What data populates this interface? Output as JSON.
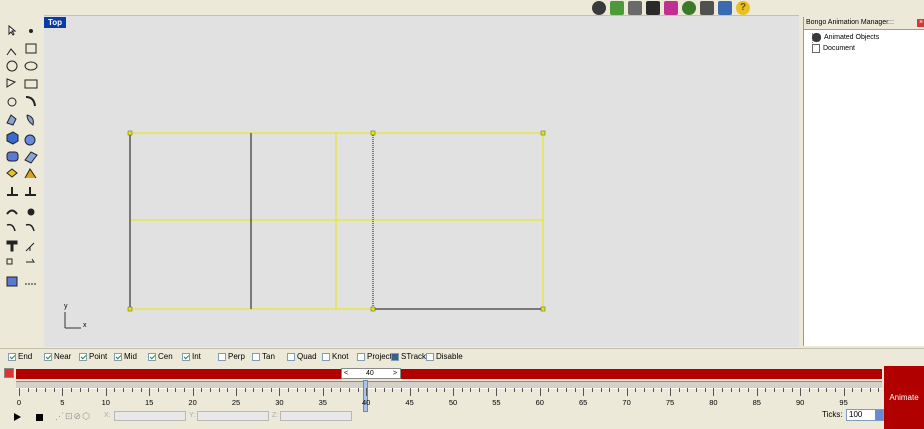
{
  "viewport": {
    "tab_label": "Top",
    "axis_x": "x",
    "axis_y": "y"
  },
  "panel": {
    "title": "Bongo Animation Manager",
    "close": "×",
    "tree": [
      {
        "label": "Animated Objects"
      },
      {
        "label": "Document"
      }
    ]
  },
  "snaps": [
    {
      "label": "End",
      "checked": true
    },
    {
      "label": "Near",
      "checked": true
    },
    {
      "label": "Point",
      "checked": true
    },
    {
      "label": "Mid",
      "checked": true
    },
    {
      "label": "Cen",
      "checked": true
    },
    {
      "label": "Int",
      "checked": true
    },
    {
      "label": "Perp",
      "checked": false
    },
    {
      "label": "Tan",
      "checked": false
    },
    {
      "label": "Quad",
      "checked": false
    },
    {
      "label": "Knot",
      "checked": false
    },
    {
      "label": "Project",
      "checked": false
    },
    {
      "label": "STrack",
      "checked": true
    },
    {
      "label": "Disable",
      "checked": false
    }
  ],
  "timeline": {
    "current_frame": "40",
    "prev": "<",
    "next": ">",
    "ticks_label": "Ticks:",
    "ticks_value": "100",
    "ruler_labels": [
      "0",
      "5",
      "10",
      "15",
      "20",
      "25",
      "30",
      "35",
      "40",
      "45",
      "50",
      "55",
      "60",
      "65",
      "70",
      "75",
      "80",
      "85",
      "90",
      "95"
    ],
    "animate_label": "Animate",
    "coord_labels": {
      "x": "X:",
      "y": "Y:",
      "z": "Z:"
    }
  },
  "colors": {
    "accent_red": "#b00000",
    "tab_blue": "#0a3ca8",
    "curve_yellow": "#e8e800"
  }
}
